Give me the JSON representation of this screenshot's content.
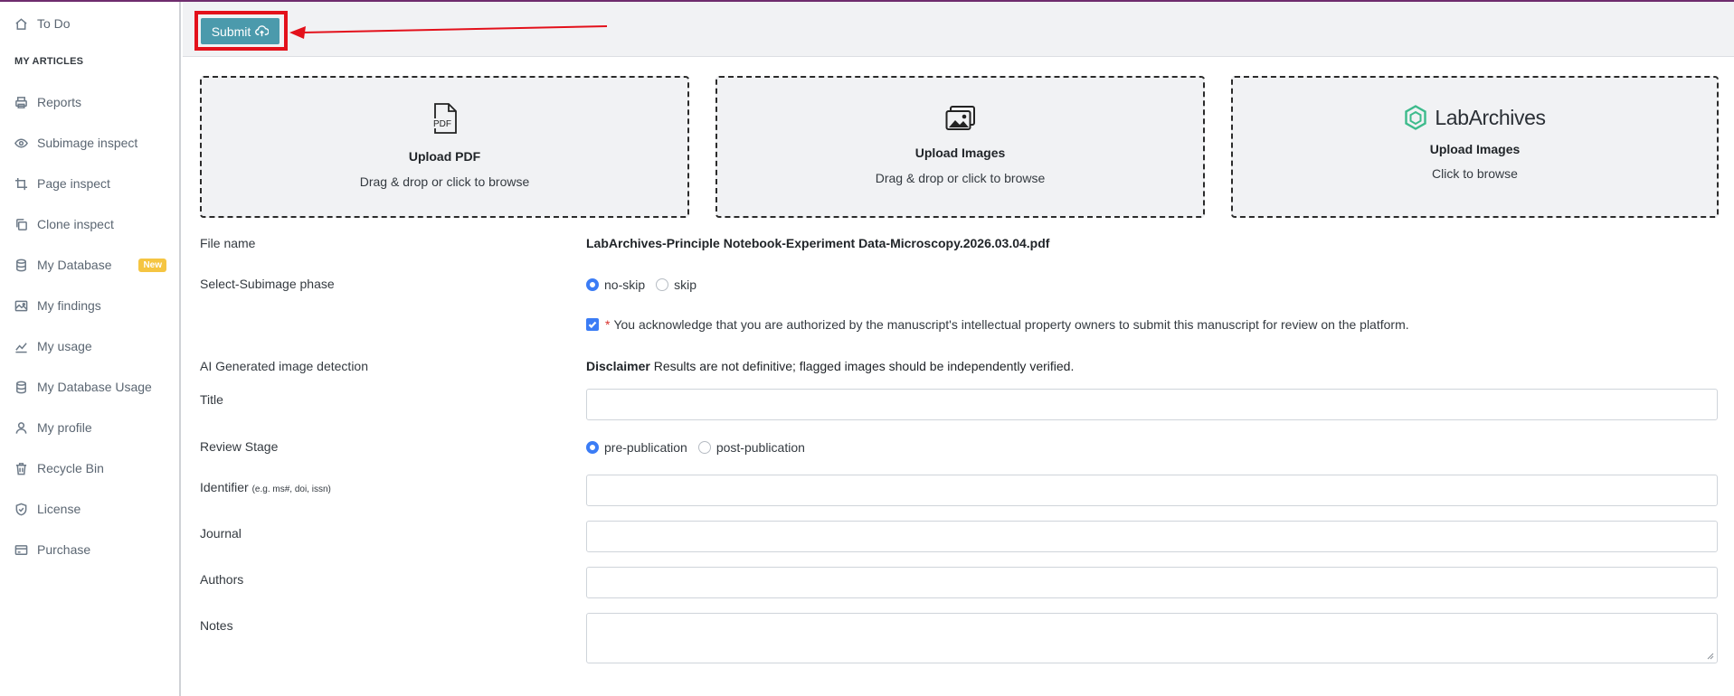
{
  "sidebar": {
    "todo": "To Do",
    "section": "MY ARTICLES",
    "items": [
      {
        "label": "Reports",
        "icon": "printer-icon"
      },
      {
        "label": "Subimage inspect",
        "icon": "eye-icon"
      },
      {
        "label": "Page inspect",
        "icon": "crop-icon"
      },
      {
        "label": "Clone inspect",
        "icon": "copy-icon"
      },
      {
        "label": "My Database",
        "icon": "database-icon",
        "badge": "New"
      },
      {
        "label": "My findings",
        "icon": "image-icon"
      },
      {
        "label": "My usage",
        "icon": "chart-line-icon"
      },
      {
        "label": "My Database Usage",
        "icon": "database-icon"
      },
      {
        "label": "My profile",
        "icon": "user-icon"
      },
      {
        "label": "Recycle Bin",
        "icon": "trash-icon"
      },
      {
        "label": "License",
        "icon": "shield-icon"
      },
      {
        "label": "Purchase",
        "icon": "credit-card-icon"
      }
    ]
  },
  "toolbar": {
    "submit_label": "Submit"
  },
  "upload": {
    "pdf": {
      "icon_text": "PDF",
      "title": "Upload PDF",
      "subtitle": "Drag & drop or click to browse"
    },
    "images": {
      "title": "Upload Images",
      "subtitle": "Drag & drop or click to browse"
    },
    "labarchives": {
      "brand": "LabArchives",
      "title": "Upload Images",
      "subtitle": "Click to browse"
    }
  },
  "form": {
    "file_name_label": "File name",
    "file_name_value": "LabArchives-Principle Notebook-Experiment Data-Microscopy.2026.03.04.pdf",
    "subimage_label": "Select-Subimage phase",
    "subimage_options": [
      "no-skip",
      "skip"
    ],
    "subimage_selected": "no-skip",
    "ack_text": "You acknowledge that you are authorized by the manuscript's intellectual property owners to submit this manuscript for review on the platform.",
    "ai_label": "AI Generated image detection",
    "disclaimer_bold": "Disclaimer",
    "disclaimer_text": "Results are not definitive; flagged images should be independently verified.",
    "title_label": "Title",
    "review_label": "Review Stage",
    "review_options": [
      "pre-publication",
      "post-publication"
    ],
    "review_selected": "pre-publication",
    "identifier_label": "Identifier",
    "identifier_hint": "(e.g. ms#, doi, issn)",
    "journal_label": "Journal",
    "authors_label": "Authors",
    "notes_label": "Notes"
  },
  "colors": {
    "accent": "#4b9aac",
    "highlight": "#e3111b",
    "radio": "#3b7cf5",
    "brand_green": "#3dbb8c"
  }
}
